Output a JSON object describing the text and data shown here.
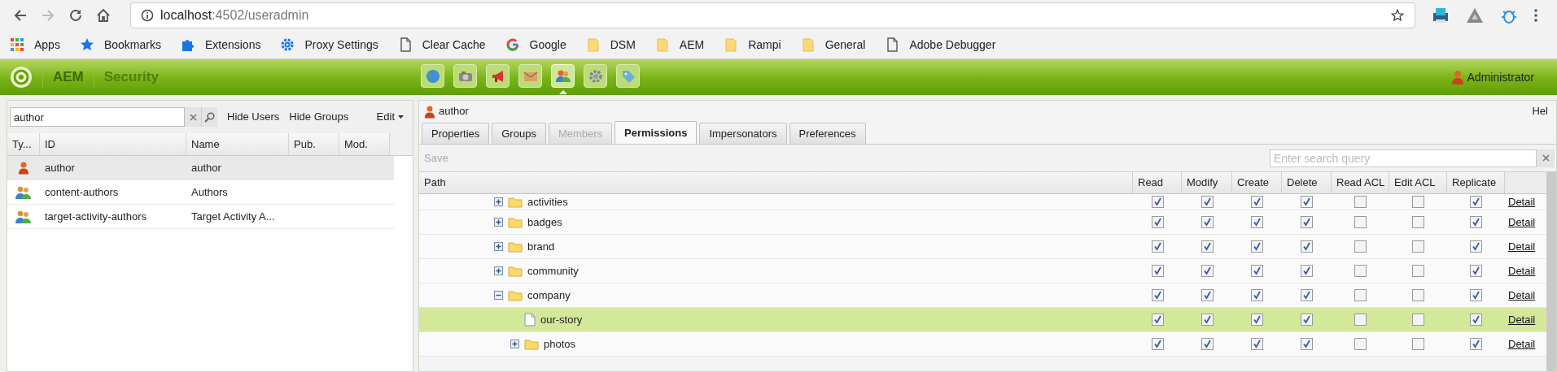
{
  "browser": {
    "url_host": "localhost",
    "url_path": ":4502/useradmin",
    "bookmarks": [
      {
        "kind": "apps",
        "label": "Apps"
      },
      {
        "kind": "star",
        "label": "Bookmarks"
      },
      {
        "kind": "puzzle",
        "label": "Extensions"
      },
      {
        "kind": "gear",
        "label": "Proxy Settings"
      },
      {
        "kind": "page",
        "label": "Clear Cache"
      },
      {
        "kind": "google",
        "label": "Google"
      },
      {
        "kind": "folder",
        "label": "DSM"
      },
      {
        "kind": "folder",
        "label": "AEM"
      },
      {
        "kind": "folder",
        "label": "Rampi"
      },
      {
        "kind": "folder",
        "label": "General"
      },
      {
        "kind": "page",
        "label": "Adobe Debugger"
      }
    ]
  },
  "header": {
    "brand": "AEM",
    "section": "Security",
    "nav_buttons": [
      {
        "kind": "globe",
        "selected": false
      },
      {
        "kind": "camera",
        "selected": false
      },
      {
        "kind": "megaphone",
        "selected": false
      },
      {
        "kind": "envelope",
        "selected": false
      },
      {
        "kind": "users",
        "selected": true
      },
      {
        "kind": "gear",
        "selected": false
      },
      {
        "kind": "tag",
        "selected": false
      }
    ],
    "user": "Administrator"
  },
  "left_panel": {
    "search_value": "author",
    "buttons": [
      "Hide Users",
      "Hide Groups"
    ],
    "edit_menu": "Edit",
    "columns": [
      "Ty...",
      "ID",
      "Name",
      "Pub.",
      "Mod."
    ],
    "rows": [
      {
        "kind": "user",
        "id": "author",
        "name": "author",
        "selected": true
      },
      {
        "kind": "group",
        "id": "content-authors",
        "name": "Authors",
        "selected": false
      },
      {
        "kind": "group",
        "id": "target-activity-authors",
        "name": "Target Activity A...",
        "selected": false
      }
    ]
  },
  "right_panel": {
    "title": "author",
    "help": "Hel",
    "tabs": [
      {
        "label": "Properties",
        "selected": false,
        "disabled": false
      },
      {
        "label": "Groups",
        "selected": false,
        "disabled": false
      },
      {
        "label": "Members",
        "selected": false,
        "disabled": true
      },
      {
        "label": "Permissions",
        "selected": true,
        "disabled": false
      },
      {
        "label": "Impersonators",
        "selected": false,
        "disabled": false
      },
      {
        "label": "Preferences",
        "selected": false,
        "disabled": false
      }
    ],
    "save_button": {
      "label": "Save",
      "disabled": true
    },
    "search": {
      "placeholder": "Enter search query"
    },
    "columns": [
      "Path",
      "Read",
      "Modify",
      "Create",
      "Delete",
      "Read ACL",
      "Edit ACL",
      "Replicate"
    ],
    "tree": [
      {
        "kind": "folder",
        "name": "activities",
        "expanded": false,
        "selected": false,
        "detail": "Detail",
        "permissions": [
          {
            "checked": true
          },
          {
            "checked": true
          },
          {
            "checked": true
          },
          {
            "checked": true
          },
          {
            "checked": false
          },
          {
            "checked": false
          },
          {
            "checked": true
          }
        ]
      },
      {
        "kind": "folder",
        "name": "badges",
        "expanded": false,
        "selected": false,
        "detail": "Detail",
        "permissions": [
          {
            "checked": true
          },
          {
            "checked": true
          },
          {
            "checked": true
          },
          {
            "checked": true
          },
          {
            "checked": false
          },
          {
            "checked": false
          },
          {
            "checked": true
          }
        ]
      },
      {
        "kind": "folder",
        "name": "brand",
        "expanded": false,
        "selected": false,
        "detail": "Detail",
        "permissions": [
          {
            "checked": true
          },
          {
            "checked": true
          },
          {
            "checked": true
          },
          {
            "checked": true
          },
          {
            "checked": false
          },
          {
            "checked": false
          },
          {
            "checked": true
          }
        ]
      },
      {
        "kind": "folder",
        "name": "community",
        "expanded": false,
        "selected": false,
        "detail": "Detail",
        "permissions": [
          {
            "checked": true
          },
          {
            "checked": true
          },
          {
            "checked": true
          },
          {
            "checked": true
          },
          {
            "checked": false
          },
          {
            "checked": false
          },
          {
            "checked": true
          }
        ]
      },
      {
        "kind": "folder",
        "name": "company",
        "expanded": true,
        "selected": false,
        "detail": "Detail",
        "permissions": [
          {
            "checked": true
          },
          {
            "checked": true
          },
          {
            "checked": true
          },
          {
            "checked": true
          },
          {
            "checked": false
          },
          {
            "checked": false
          },
          {
            "checked": true
          }
        ],
        "children": [
          {
            "kind": "page",
            "name": "our-story",
            "selected": true,
            "detail": "Detail",
            "permissions": [
              {
                "checked": true
              },
              {
                "checked": true
              },
              {
                "checked": true
              },
              {
                "checked": true
              },
              {
                "checked": false
              },
              {
                "checked": false
              },
              {
                "checked": true
              }
            ]
          },
          {
            "kind": "folder",
            "name": "photos",
            "expanded": false,
            "selected": false,
            "detail": "Detail",
            "permissions": [
              {
                "checked": true
              },
              {
                "checked": true
              },
              {
                "checked": true
              },
              {
                "checked": true
              },
              {
                "checked": false
              },
              {
                "checked": false
              },
              {
                "checked": true
              }
            ]
          }
        ]
      }
    ]
  }
}
